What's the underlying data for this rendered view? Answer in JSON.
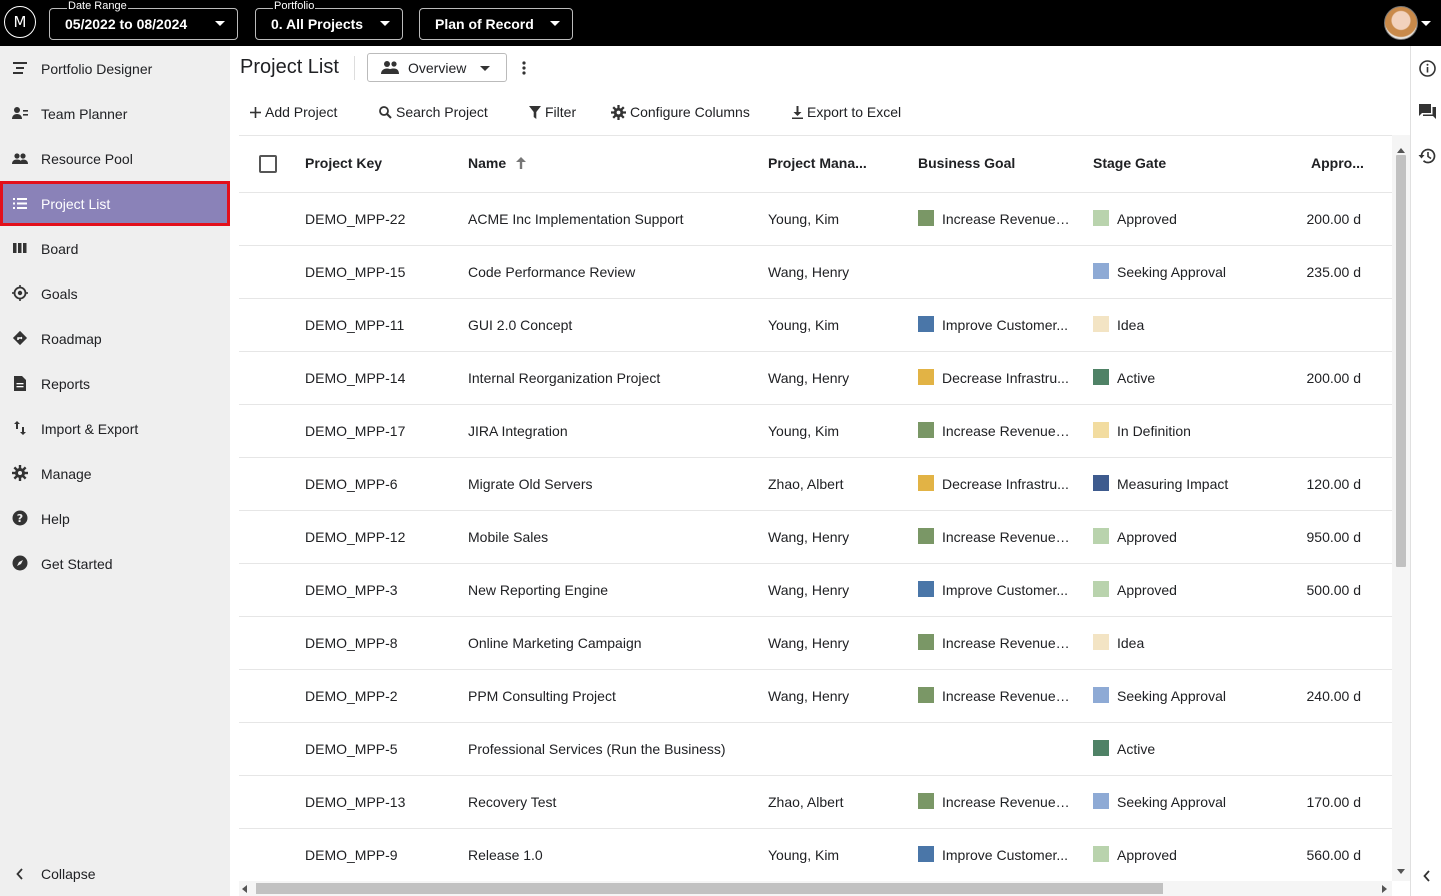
{
  "topbar": {
    "logo": "M",
    "date_range": {
      "label": "Date Range",
      "value": "05/2022 to 08/2024"
    },
    "portfolio": {
      "label": "Portfolio",
      "value": "0. All Projects"
    },
    "plan": {
      "value": "Plan of Record"
    }
  },
  "sidebar": {
    "items": [
      {
        "label": "Portfolio Designer",
        "icon": "portfolio-designer-icon"
      },
      {
        "label": "Team Planner",
        "icon": "team-planner-icon"
      },
      {
        "label": "Resource Pool",
        "icon": "resource-pool-icon"
      },
      {
        "label": "Project List",
        "icon": "list-icon",
        "active": true
      },
      {
        "label": "Board",
        "icon": "board-icon"
      },
      {
        "label": "Goals",
        "icon": "goals-icon"
      },
      {
        "label": "Roadmap",
        "icon": "roadmap-icon"
      },
      {
        "label": "Reports",
        "icon": "reports-icon"
      },
      {
        "label": "Import & Export",
        "icon": "import-export-icon"
      },
      {
        "label": "Manage",
        "icon": "gear-icon"
      },
      {
        "label": "Help",
        "icon": "help-icon"
      },
      {
        "label": "Get Started",
        "icon": "compass-icon"
      }
    ],
    "collapse_label": "Collapse"
  },
  "main": {
    "title": "Project List",
    "view": "Overview",
    "toolbar": {
      "add": "Add Project",
      "search": "Search Project",
      "filter": "Filter",
      "configure": "Configure Columns",
      "export": "Export to Excel"
    }
  },
  "table": {
    "columns": {
      "key": "Project Key",
      "name": "Name",
      "manager": "Project Mana...",
      "goal": "Business Goal",
      "stage": "Stage Gate",
      "approved": "Appro..."
    },
    "rows": [
      {
        "key": "DEMO_MPP-22",
        "name": "ACME Inc Implementation Support",
        "manager": "Young, Kim",
        "goal": "Increase Revenue ...",
        "goal_color": "#7a9766",
        "stage": "Approved",
        "stage_color": "#b9d3ad",
        "approved": "200.00 d"
      },
      {
        "key": "DEMO_MPP-15",
        "name": "Code Performance Review",
        "manager": "Wang, Henry",
        "goal": "",
        "goal_color": "",
        "stage": "Seeking Approval",
        "stage_color": "#8eaad5",
        "approved": "235.00 d"
      },
      {
        "key": "DEMO_MPP-11",
        "name": "GUI 2.0 Concept",
        "manager": "Young, Kim",
        "goal": "Improve Customer...",
        "goal_color": "#4a76a8",
        "stage": "Idea",
        "stage_color": "#f3e4c4",
        "approved": ""
      },
      {
        "key": "DEMO_MPP-14",
        "name": "Internal Reorganization Project",
        "manager": "Wang, Henry",
        "goal": "Decrease Infrastru...",
        "goal_color": "#e2b345",
        "stage": "Active",
        "stage_color": "#4f8266",
        "approved": "200.00 d"
      },
      {
        "key": "DEMO_MPP-17",
        "name": "JIRA Integration",
        "manager": "Young, Kim",
        "goal": "Increase Revenue ...",
        "goal_color": "#7a9766",
        "stage": "In Definition",
        "stage_color": "#f2dca0",
        "approved": ""
      },
      {
        "key": "DEMO_MPP-6",
        "name": "Migrate Old Servers",
        "manager": "Zhao, Albert",
        "goal": "Decrease Infrastru...",
        "goal_color": "#e2b345",
        "stage": "Measuring Impact",
        "stage_color": "#3e5b8e",
        "approved": "120.00 d"
      },
      {
        "key": "DEMO_MPP-12",
        "name": "Mobile Sales",
        "manager": "Wang, Henry",
        "goal": "Increase Revenue ...",
        "goal_color": "#7a9766",
        "stage": "Approved",
        "stage_color": "#b9d3ad",
        "approved": "950.00 d"
      },
      {
        "key": "DEMO_MPP-3",
        "name": "New Reporting Engine",
        "manager": "Wang, Henry",
        "goal": "Improve Customer...",
        "goal_color": "#4a76a8",
        "stage": "Approved",
        "stage_color": "#b9d3ad",
        "approved": "500.00 d"
      },
      {
        "key": "DEMO_MPP-8",
        "name": "Online Marketing Campaign",
        "manager": "Wang, Henry",
        "goal": "Increase Revenue ...",
        "goal_color": "#7a9766",
        "stage": "Idea",
        "stage_color": "#f3e4c4",
        "approved": ""
      },
      {
        "key": "DEMO_MPP-2",
        "name": "PPM Consulting Project",
        "manager": "Wang, Henry",
        "goal": "Increase Revenue ...",
        "goal_color": "#7a9766",
        "stage": "Seeking Approval",
        "stage_color": "#8eaad5",
        "approved": "240.00 d"
      },
      {
        "key": "DEMO_MPP-5",
        "name": "Professional Services (Run the Business)",
        "manager": "",
        "goal": "",
        "goal_color": "",
        "stage": "Active",
        "stage_color": "#4f8266",
        "approved": ""
      },
      {
        "key": "DEMO_MPP-13",
        "name": "Recovery Test",
        "manager": "Zhao, Albert",
        "goal": "Increase Revenue ...",
        "goal_color": "#7a9766",
        "stage": "Seeking Approval",
        "stage_color": "#8eaad5",
        "approved": "170.00 d"
      },
      {
        "key": "DEMO_MPP-9",
        "name": "Release 1.0",
        "manager": "Young, Kim",
        "goal": "Improve Customer...",
        "goal_color": "#4a76a8",
        "stage": "Approved",
        "stage_color": "#b9d3ad",
        "approved": "560.00 d"
      }
    ]
  },
  "colors": {
    "active_nav": "#8a82b8",
    "highlight": "#e3101b",
    "topbar": "#000000"
  }
}
